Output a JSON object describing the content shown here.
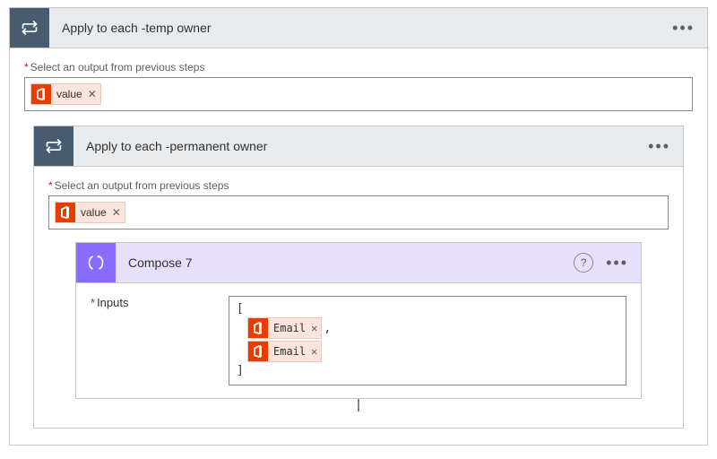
{
  "outer": {
    "title": "Apply to each -temp owner",
    "select_label": "Select an output from previous steps",
    "token": "value"
  },
  "inner": {
    "title": "Apply to each -permanent owner",
    "select_label": "Select an output from previous steps",
    "token": "value"
  },
  "compose": {
    "title": "Compose 7",
    "inputs_label": "Inputs",
    "open_bracket": "[",
    "close_bracket": "]",
    "comma": ",",
    "tokens": [
      "Email",
      "Email"
    ]
  }
}
